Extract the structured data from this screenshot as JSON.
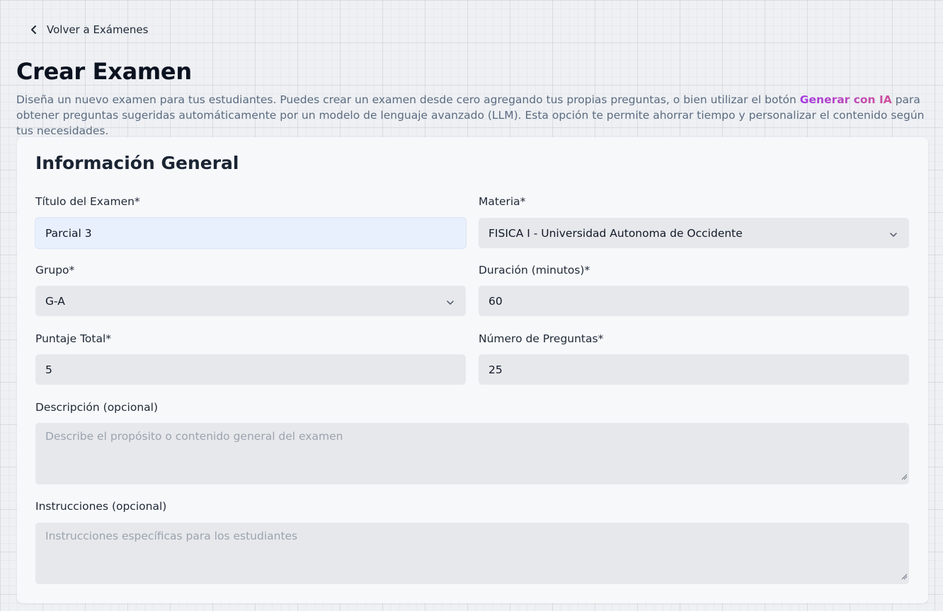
{
  "nav": {
    "back_label": "Volver a Exámenes"
  },
  "header": {
    "title": "Crear Examen",
    "description_before": "Diseña un nuevo examen para tus estudiantes. Puedes crear un examen desde cero agregando tus propias preguntas, o bien utilizar el botón ",
    "ai_highlight": "Generar con IA",
    "description_after": " para obtener preguntas sugeridas automáticamente por un modelo de lenguaje avanzado (LLM). Esta opción te permite ahorrar tiempo y personalizar el contenido según tus necesidades."
  },
  "form": {
    "section_title": "Información General",
    "titulo": {
      "label": "Título del Examen*",
      "value": "Parcial 3"
    },
    "materia": {
      "label": "Materia*",
      "value": "FISICA I - Universidad Autonoma de Occidente"
    },
    "grupo": {
      "label": "Grupo*",
      "value": "G-A"
    },
    "duracion": {
      "label": "Duración (minutos)*",
      "value": "60"
    },
    "puntaje": {
      "label": "Puntaje Total*",
      "value": "5"
    },
    "preguntas": {
      "label": "Número de Preguntas*",
      "value": "25"
    },
    "descripcion": {
      "label": "Descripción (opcional)",
      "placeholder": "Describe el propósito o contenido general del examen"
    },
    "instrucciones": {
      "label": "Instrucciones (opcional)",
      "placeholder": "Instrucciones específicas para los estudiantes"
    }
  },
  "icons": {
    "back": "chevron-left-icon",
    "dropdown": "chevron-down-icon"
  },
  "colors": {
    "ai_gradient_start": "#a43ce0",
    "ai_gradient_end": "#d0509a",
    "focused_field": "#e9f0fd",
    "field_bg": "#e6e8eb"
  }
}
